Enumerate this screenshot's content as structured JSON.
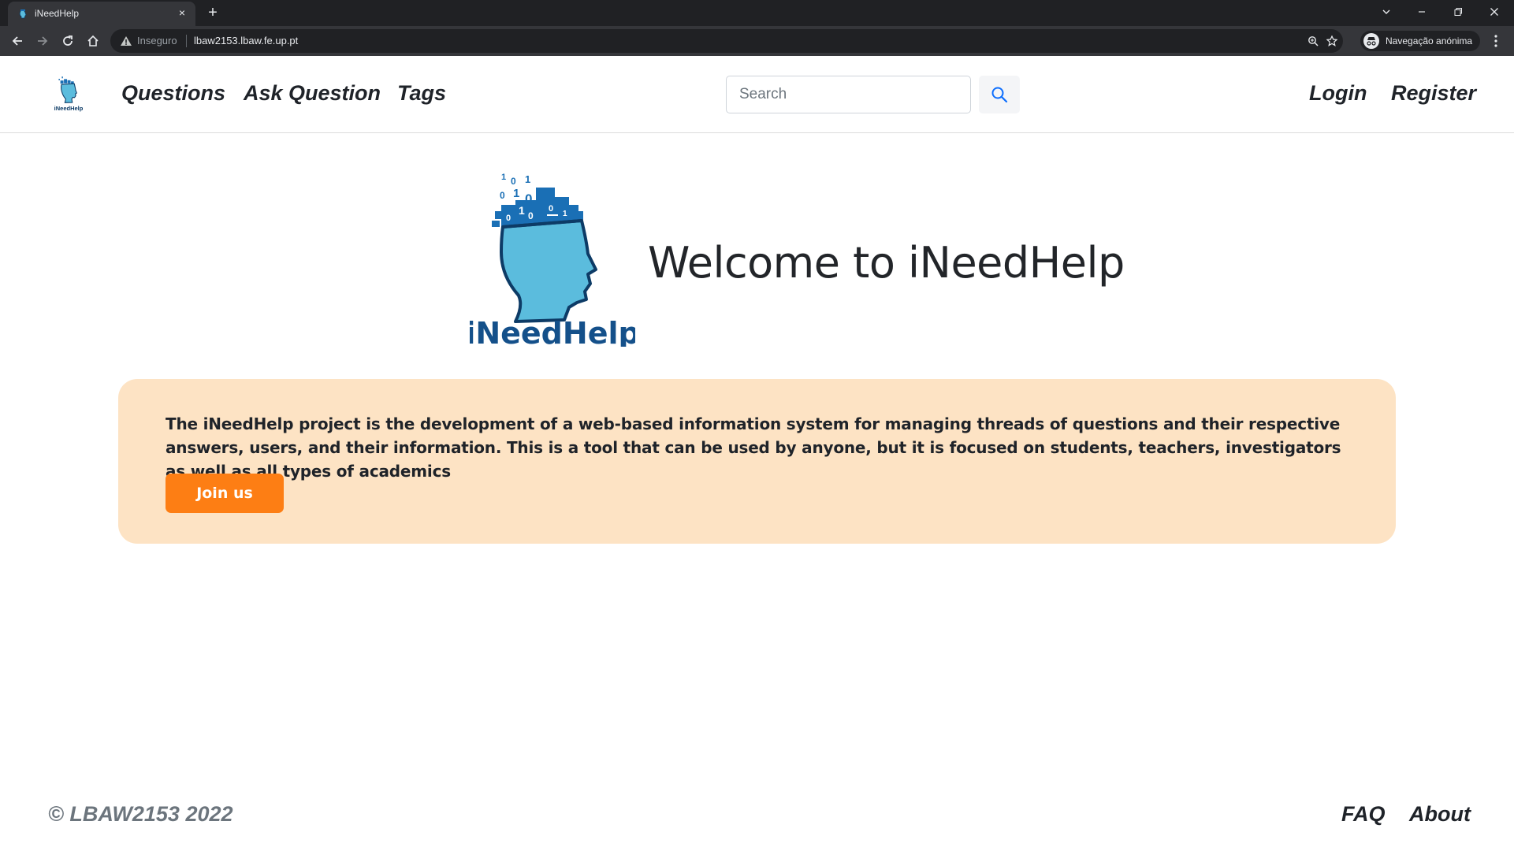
{
  "browser": {
    "tab_title": "iNeedHelp",
    "new_tab_glyph": "+",
    "close_tab_glyph": "×",
    "insecure_label": "Inseguro",
    "url": "lbaw2153.lbaw.fe.up.pt",
    "incognito_label": "Navegação anónima",
    "icons": [
      "back-icon",
      "forward-icon",
      "reload-icon",
      "home-icon",
      "warning-icon",
      "zoom-icon",
      "star-icon",
      "incognito-icon",
      "menu-icon",
      "minimize-icon",
      "restore-icon",
      "close-icon",
      "tab-list-icon"
    ]
  },
  "nav": {
    "links": [
      "Questions",
      "Ask Question",
      "Tags"
    ],
    "search_placeholder": "Search",
    "auth": [
      "Login",
      "Register"
    ]
  },
  "hero": {
    "logo_text": "iNeedHelp",
    "title": "Welcome to iNeedHelp"
  },
  "info": {
    "text": "The iNeedHelp project is the development of a web-based information system for managing threads of questions and their respective answers, users, and their information. This is a tool that can be used by anyone, but it is focused on students, teachers, investigators as well as all types of academics",
    "button_label": "Join us"
  },
  "footer": {
    "copyright": "© LBAW2153 2022",
    "links": [
      "FAQ",
      "About"
    ]
  },
  "colors": {
    "accent": "#fd7e14",
    "info_bg": "#fde3c4",
    "logo_blue": "#1a6fb5",
    "logo_light": "#5bbcdd",
    "logo_dark": "#0d3b66"
  }
}
